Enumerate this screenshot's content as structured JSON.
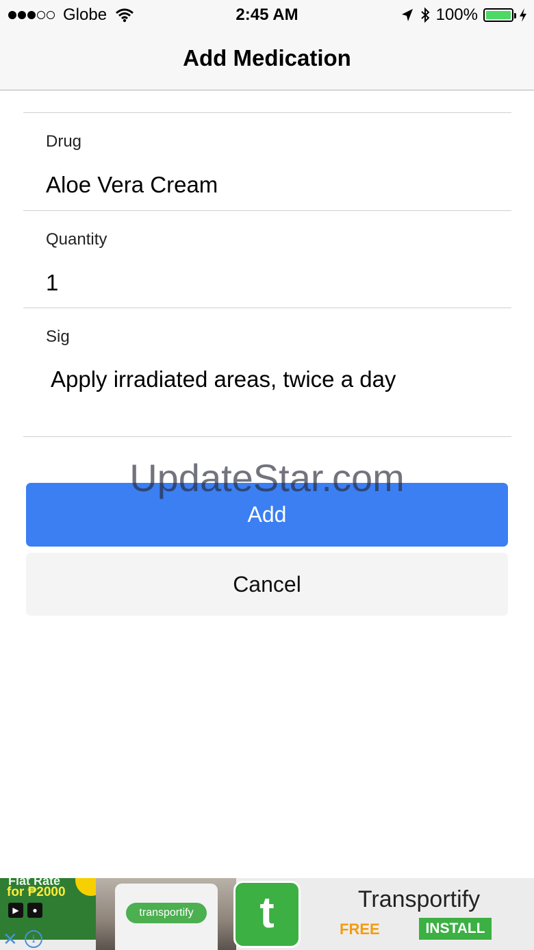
{
  "status_bar": {
    "signal": {
      "full": 3,
      "empty": 2
    },
    "carrier": "Globe",
    "time": "2:45 AM",
    "battery": "100%",
    "battery_level": 1.0,
    "icons": [
      "wifi-icon",
      "location-arrow-icon",
      "bluetooth-icon",
      "battery-icon",
      "charging-bolt-icon"
    ]
  },
  "nav": {
    "title": "Add Medication"
  },
  "form": {
    "drug": {
      "label": "Drug",
      "value": "Aloe Vera Cream"
    },
    "quantity": {
      "label": "Quantity",
      "value": "1"
    },
    "sig": {
      "label": "Sig",
      "value": "Apply irradiated areas, twice a day"
    }
  },
  "buttons": {
    "add": "Add",
    "cancel": "Cancel"
  },
  "watermark": "UpdateStar.com",
  "ad": {
    "promo_line1": "Flat Rate",
    "promo_line2": "for ₱2000",
    "van_logo": "transportify",
    "app_name": "Transportify",
    "price": "FREE",
    "install": "INSTALL",
    "close_icon": "close-x-icon",
    "info_icon": "info-icon"
  },
  "colors": {
    "accent": "#3b7ff2",
    "battery_green": "#4cd964",
    "ad_green": "#3cb043",
    "free_orange": "#f39c12"
  }
}
